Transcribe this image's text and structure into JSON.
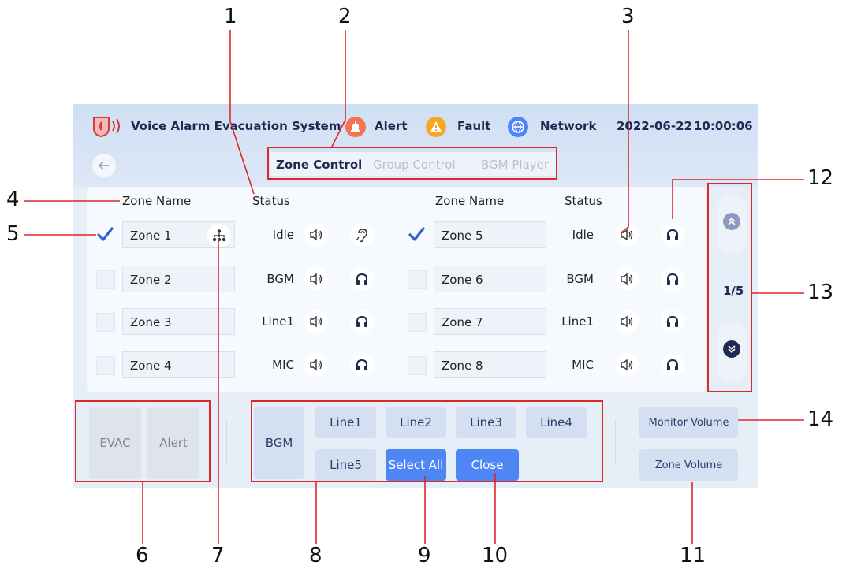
{
  "header": {
    "app_title": "Voice Alarm Evacuation System",
    "alert_label": "Alert",
    "fault_label": "Fault",
    "network_label": "Network",
    "date": "2022-06-22",
    "time": "10:00:06"
  },
  "tabs": [
    "Zone Control",
    "Group Control",
    "BGM Player"
  ],
  "columns": {
    "zone_name": "Zone Name",
    "status": "Status"
  },
  "zones": [
    {
      "name": "Zone 1",
      "status": "Idle",
      "checked": true
    },
    {
      "name": "Zone 2",
      "status": "BGM",
      "checked": false
    },
    {
      "name": "Zone 3",
      "status": "Line1",
      "checked": false
    },
    {
      "name": "Zone 4",
      "status": "MIC",
      "checked": false
    },
    {
      "name": "Zone 5",
      "status": "Idle",
      "checked": true
    },
    {
      "name": "Zone 6",
      "status": "BGM",
      "checked": false
    },
    {
      "name": "Zone 7",
      "status": "Line1",
      "checked": false
    },
    {
      "name": "Zone 8",
      "status": "MIC",
      "checked": false
    }
  ],
  "pager": {
    "page": "1/5"
  },
  "bottom": {
    "evac": "EVAC",
    "alert": "Alert",
    "bgm": "BGM",
    "lines": [
      "Line1",
      "Line2",
      "Line3",
      "Line4",
      "Line5"
    ],
    "select_all": "Select All",
    "close": "Close",
    "monitor_volume": "Monitor Volume",
    "zone_volume": "Zone Volume"
  },
  "callouts": [
    "1",
    "2",
    "3",
    "4",
    "5",
    "6",
    "7",
    "8",
    "9",
    "10",
    "11",
    "12",
    "13",
    "14"
  ],
  "colors": {
    "callout": "#e0262b",
    "accent": "#4f86f5",
    "header_text": "#1e2a52"
  }
}
